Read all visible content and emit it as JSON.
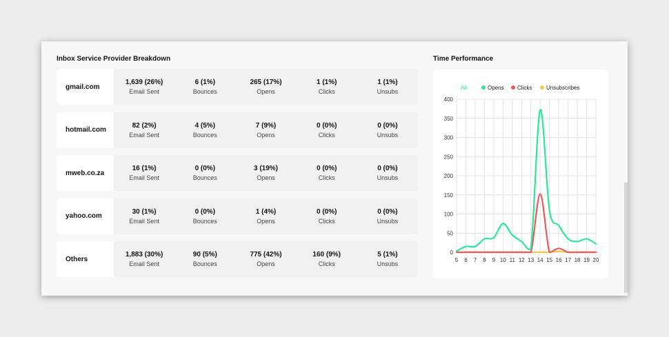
{
  "isp_breakdown": {
    "title": "Inbox Service Provider Breakdown",
    "rows": [
      {
        "name": "gmail.com",
        "stats": [
          {
            "value": "1,639 (26%)",
            "label": "Email Sent"
          },
          {
            "value": "6 (1%)",
            "label": "Bounces"
          },
          {
            "value": "265 (17%)",
            "label": "Opens"
          },
          {
            "value": "1 (1%)",
            "label": "Clicks"
          },
          {
            "value": "1 (1%)",
            "label": "Unsubs"
          }
        ]
      },
      {
        "name": "hotmail.com",
        "stats": [
          {
            "value": "82 (2%)",
            "label": "Email Sent"
          },
          {
            "value": "4 (5%)",
            "label": "Bounces"
          },
          {
            "value": "7 (9%)",
            "label": "Opens"
          },
          {
            "value": "0 (0%)",
            "label": "Clicks"
          },
          {
            "value": "0 (0%)",
            "label": "Unsubs"
          }
        ]
      },
      {
        "name": "mweb.co.za",
        "stats": [
          {
            "value": "16 (1%)",
            "label": "Email Sent"
          },
          {
            "value": "0 (0%)",
            "label": "Bounces"
          },
          {
            "value": "3 (19%)",
            "label": "Opens"
          },
          {
            "value": "0 (0%)",
            "label": "Clicks"
          },
          {
            "value": "0 (0%)",
            "label": "Unsubs"
          }
        ]
      },
      {
        "name": "yahoo.com",
        "stats": [
          {
            "value": "30 (1%)",
            "label": "Email Sent"
          },
          {
            "value": "0 (0%)",
            "label": "Bounces"
          },
          {
            "value": "1 (4%)",
            "label": "Opens"
          },
          {
            "value": "0 (0%)",
            "label": "Clicks"
          },
          {
            "value": "0 (0%)",
            "label": "Unsubs"
          }
        ]
      },
      {
        "name": "Others",
        "stats": [
          {
            "value": "1,883 (30%)",
            "label": "Email Sent"
          },
          {
            "value": "90 (5%)",
            "label": "Bounces"
          },
          {
            "value": "775 (42%)",
            "label": "Opens"
          },
          {
            "value": "160 (9%)",
            "label": "Clicks"
          },
          {
            "value": "5 (1%)",
            "label": "Unsubs"
          }
        ]
      }
    ]
  },
  "time_performance": {
    "title": "Time Performance",
    "legend": [
      {
        "label": "All",
        "color": "#2ee59d",
        "active": true
      },
      {
        "label": "Opens",
        "color": "#2ee59d"
      },
      {
        "label": "Clicks",
        "color": "#e85a5a"
      },
      {
        "label": "Unsubscribes",
        "color": "#f5c84c"
      }
    ]
  },
  "chart_data": {
    "type": "line",
    "x": [
      5,
      6,
      7,
      8,
      9,
      10,
      11,
      12,
      13,
      14,
      15,
      16,
      17,
      18,
      19,
      20
    ],
    "ylim": [
      0,
      400
    ],
    "yticks": [
      0,
      50,
      100,
      150,
      200,
      250,
      300,
      350,
      400
    ],
    "grid": true,
    "legend_position": "top",
    "series": [
      {
        "name": "Opens",
        "color": "#2ee59d",
        "values": [
          3,
          15,
          15,
          35,
          38,
          75,
          45,
          28,
          10,
          372,
          110,
          70,
          35,
          28,
          35,
          22
        ]
      },
      {
        "name": "Clicks",
        "color": "#e85a5a",
        "values": [
          0,
          0,
          0,
          0,
          0,
          0,
          0,
          0,
          0,
          152,
          0,
          10,
          0,
          0,
          0,
          0
        ]
      },
      {
        "name": "Unsubscribes",
        "color": "#f5c84c",
        "values": [
          0,
          0,
          0,
          0,
          0,
          0,
          0,
          0,
          0,
          0,
          0,
          2,
          0,
          0,
          0,
          0
        ]
      }
    ]
  }
}
